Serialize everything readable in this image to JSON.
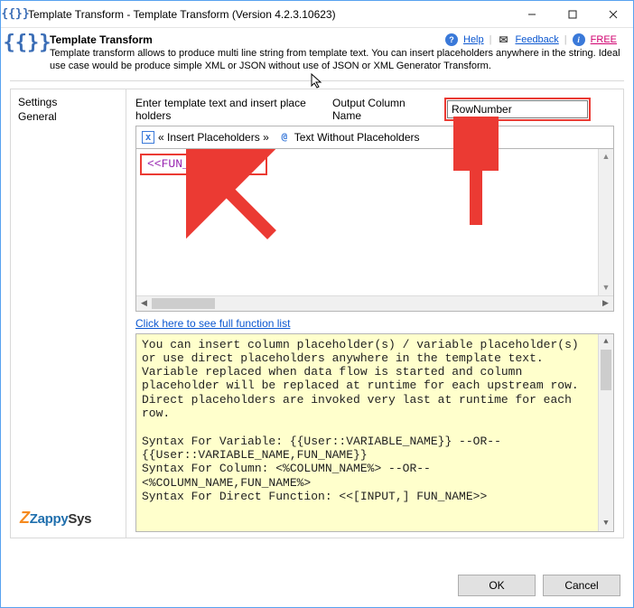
{
  "window": {
    "title": "Template Transform - Template Transform (Version 4.2.3.10623)"
  },
  "header": {
    "name": "Template Transform",
    "desc": "Template transform allows to produce multi line string from template text. You can insert placeholders anywhere in the string. Ideal use case would be produce simple XML or JSON without use of JSON or XML Generator Transform.",
    "links": {
      "help": "Help",
      "feedback": "Feedback",
      "free": "FREE"
    }
  },
  "sidebar": {
    "items": [
      "Settings",
      "General"
    ]
  },
  "labels": {
    "enter_template": "Enter template text and insert place holders",
    "output_col": "Output Column Name"
  },
  "inputs": {
    "output_col_value": "RowNumber"
  },
  "toolbar": {
    "insert_placeholders": "« Insert Placeholders »",
    "text_without": "Text Without Placeholders"
  },
  "editor": {
    "placeholder_token": "<<FUN_SEQUENCE>>"
  },
  "link_full_functions": "Click here to see full function list",
  "help_text": "You can insert column placeholder(s) / variable placeholder(s) or use direct placeholders anywhere in the template text. Variable replaced when data flow is started and column placeholder will be replaced at runtime for each upstream row. Direct placeholders are invoked very last at runtime for each row.\n\nSyntax For Variable: {{User::VARIABLE_NAME}} --OR-- {{User::VARIABLE_NAME,FUN_NAME}}\nSyntax For Column: <%COLUMN_NAME%> --OR-- <%COLUMN_NAME,FUN_NAME%>\nSyntax For Direct Function: <<[INPUT,] FUN_NAME>>",
  "footer": {
    "ok": "OK",
    "cancel": "Cancel"
  },
  "logo": {
    "z": "Z",
    "zappy": "Zappy",
    "sys": "Sys"
  }
}
